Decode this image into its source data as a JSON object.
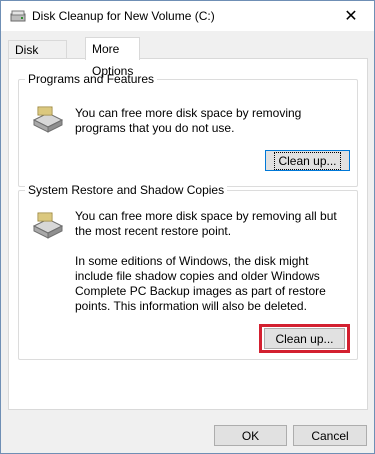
{
  "window": {
    "title": "Disk Cleanup for New Volume (C:)",
    "close_glyph": "✕"
  },
  "tabs": [
    {
      "label": "Disk Cleanup",
      "selected": false
    },
    {
      "label": "More Options",
      "selected": true
    }
  ],
  "programs": {
    "group_label": "Programs and Features",
    "description": "You can free more disk space by removing programs that you do not use.",
    "button_label": "Clean up..."
  },
  "restore": {
    "group_label": "System Restore and Shadow Copies",
    "description": "You can free more disk space by removing all but the most recent restore point.",
    "note": "In some editions of Windows, the disk might include file shadow copies and older Windows Complete PC Backup images as part of restore points. This information will also be deleted.",
    "button_label": "Clean up..."
  },
  "footer": {
    "ok_label": "OK",
    "cancel_label": "Cancel"
  },
  "colors": {
    "highlight": "#d32030",
    "focus_border": "#0078d7"
  },
  "icons": {
    "app": "disk-cleanup-icon",
    "programs": "hard-drive-icon",
    "restore": "hard-drive-icon",
    "close": "close-icon"
  }
}
